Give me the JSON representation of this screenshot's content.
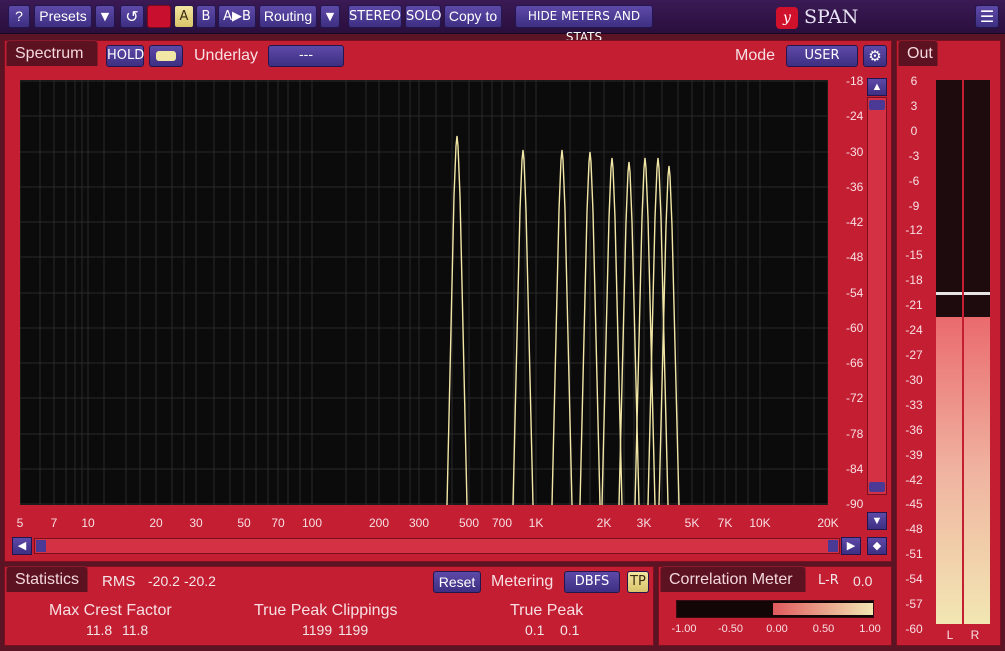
{
  "topbar": {
    "help": "?",
    "presets": "Presets",
    "presets_arrow": "▼",
    "undo_icon": "↺",
    "ab_a": "A",
    "ab_b": "B",
    "ab_copy": "A▶B",
    "routing": "Routing",
    "routing_arrow": "▼",
    "stereo": "STEREO",
    "solo": "SOLO",
    "copy_to": "Copy to",
    "hide_meters": "HIDE METERS AND STATS",
    "brand": "SPAN",
    "logo_text": "y",
    "menu_icon": "☰"
  },
  "spectrum": {
    "tab": "Spectrum",
    "hold": "HOLD",
    "underlay_label": "Underlay",
    "underlay_value": "---",
    "mode_label": "Mode",
    "mode_value": "USER",
    "y_ticks": [
      "-18",
      "-24",
      "-30",
      "-36",
      "-42",
      "-48",
      "-54",
      "-60",
      "-66",
      "-72",
      "-78",
      "-84",
      "-90"
    ],
    "x_ticks": [
      "5",
      "7",
      "10",
      "20",
      "30",
      "50",
      "70",
      "100",
      "200",
      "300",
      "500",
      "700",
      "1K",
      "2K",
      "3K",
      "5K",
      "7K",
      "10K",
      "20K"
    ]
  },
  "out": {
    "tab": "Out",
    "ticks": [
      "6",
      "3",
      "0",
      "-3",
      "-6",
      "-9",
      "-12",
      "-15",
      "-18",
      "-21",
      "-24",
      "-27",
      "-30",
      "-33",
      "-36",
      "-39",
      "-42",
      "-45",
      "-48",
      "-51",
      "-54",
      "-57",
      "-60"
    ],
    "ch_left": "L",
    "ch_right": "R"
  },
  "statistics": {
    "tab": "Statistics",
    "rms_label": "RMS",
    "rms_left": "-20.2",
    "rms_right": "-20.2",
    "reset": "Reset",
    "metering_label": "Metering",
    "metering_value": "DBFS",
    "tp": "TP",
    "crest_label": "Max Crest Factor",
    "crest_left": "11.8",
    "crest_right": "11.8",
    "clip_label": "True Peak Clippings",
    "clip_left": "1199",
    "clip_right": "1199",
    "tpeak_label": "True Peak",
    "tpeak_left": "0.1",
    "tpeak_right": "0.1"
  },
  "correlation": {
    "tab": "Correlation Meter",
    "lr_label": "L-R",
    "lr_value": "0.0",
    "ticks": [
      "-1.00",
      "-0.50",
      "0.00",
      "0.50",
      "1.00"
    ]
  },
  "colors": {
    "panel": "#c41e33",
    "plot_bg": "#0c0b0c",
    "spectrum_line": "#f3e7a6",
    "button": "#4a3a95"
  }
}
